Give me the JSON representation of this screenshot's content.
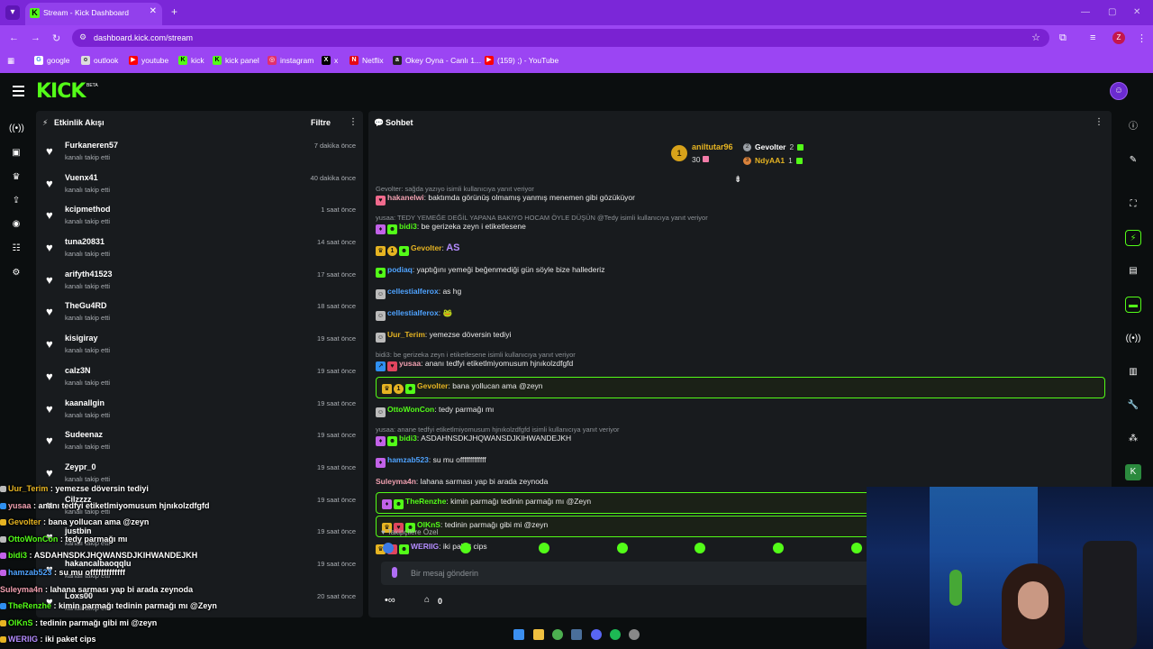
{
  "browser": {
    "tab_title": "Stream - Kick Dashboard",
    "url": "dashboard.kick.com/stream",
    "profile_initial": "Z",
    "bookmarks": [
      {
        "label": "google",
        "color": "#ffffff"
      },
      {
        "label": "outlook",
        "color": "#e0e0e0"
      },
      {
        "label": "youtube",
        "color": "#ff0000"
      },
      {
        "label": "kick",
        "color": "#53fc18"
      },
      {
        "label": "kick panel",
        "color": "#53fc18"
      },
      {
        "label": "instagram",
        "color": "#e1306c"
      },
      {
        "label": "x",
        "color": "#000000"
      },
      {
        "label": "Netflix",
        "color": "#e50914"
      },
      {
        "label": "Okey Oyna - Canlı 1...",
        "color": "#222222"
      },
      {
        "label": "(159) ;) - YouTube",
        "color": "#ff0000"
      }
    ]
  },
  "brand": {
    "logo": "KICK",
    "beta": "BETA",
    "accent": "#53fc18"
  },
  "feed": {
    "title": "Etkinlik Akışı",
    "filter_label": "Filtre",
    "items": [
      {
        "name": "Furkaneren57",
        "action": "kanalı takip etti",
        "time": "7 dakika önce"
      },
      {
        "name": "Vuenx41",
        "action": "kanalı takip etti",
        "time": "40 dakika önce"
      },
      {
        "name": "kcipmethod",
        "action": "kanalı takip etti",
        "time": "1 saat önce"
      },
      {
        "name": "tuna20831",
        "action": "kanalı takip etti",
        "time": "14 saat önce"
      },
      {
        "name": "arifyth41523",
        "action": "kanalı takip etti",
        "time": "17 saat önce"
      },
      {
        "name": "TheGu4RD",
        "action": "kanalı takip etti",
        "time": "18 saat önce"
      },
      {
        "name": "kisigiray",
        "action": "kanalı takip etti",
        "time": "19 saat önce"
      },
      {
        "name": "calz3N",
        "action": "kanalı takip etti",
        "time": "19 saat önce"
      },
      {
        "name": "kaanallgin",
        "action": "kanalı takip etti",
        "time": "19 saat önce"
      },
      {
        "name": "Sudeenaz",
        "action": "kanalı takip etti",
        "time": "19 saat önce"
      },
      {
        "name": "Zeypr_0",
        "action": "kanalı takip etti",
        "time": "19 saat önce"
      },
      {
        "name": "Cilzzzz",
        "action": "kanalı takip etti",
        "time": "19 saat önce"
      },
      {
        "name": "justbin",
        "action": "kanalı takip etti",
        "time": "19 saat önce"
      },
      {
        "name": "hakancalbaoqqlu",
        "action": "kanalı takip etti",
        "time": "19 saat önce"
      },
      {
        "name": "Loxs00",
        "action": "kanalı takip etti",
        "time": "20 saat önce"
      }
    ]
  },
  "chat": {
    "title": "Sohbet",
    "leaderboard": {
      "first_name": "aniltutar96",
      "first_count": "30",
      "second_name": "Gevolter",
      "second_count": "2",
      "third_name": "NdyAA1",
      "third_count": "1"
    },
    "messages": [
      {
        "reply": "Gevolter: sağda yazıyo isimli kullanıcıya yanıt veriyor",
        "user": "hakanelwi",
        "color": "#f0a0b0",
        "text": "baktımda görünüş olmamış yanmış menemen gibi gözüküyor"
      },
      {
        "reply": "yusaa: TEDY YEMEĞE DEĞİL YAPANA BAKIYO HOCAM ÖYLE DÜŞÜN @Tedy isimli kullanıcıya yanıt veriyor",
        "user": "bidi3",
        "color": "#53fc18",
        "text": "be gerizeka zeyn i etiketlesene"
      },
      {
        "user": "Gevolter",
        "color": "#e6b422",
        "text": "AS"
      },
      {
        "user": "podiaq",
        "color": "#4fa3ff",
        "text": "yaptığını yemeği beğenmediği gün söyle bize hallederiz"
      },
      {
        "user": "cellestialferox",
        "color": "#4fa3ff",
        "text": "as hg"
      },
      {
        "user": "cellestialferox",
        "color": "#4fa3ff",
        "text": "🐸"
      },
      {
        "user": "Uur_Terim",
        "color": "#e6b422",
        "text": "yemezse döversin tediyi"
      },
      {
        "reply": "bidi3: be gerizeka zeyn i etiketlesene isimli kullanıcıya yanıt veriyor",
        "user": "yusaa",
        "color": "#f0a0b0",
        "text": "ananı tedfyi etiketlmiyomusum hjnıkolzdfgfd"
      },
      {
        "user": "Gevolter",
        "color": "#e6b422",
        "text": "bana yollucan ama @zeyn",
        "highlight": true
      },
      {
        "user": "OttoWonCon",
        "color": "#53fc18",
        "text": "tedy parmağı mı"
      },
      {
        "reply": "yusaa: anane tedfyi etiketlmiyomusum hjnıkolzdfgfd isimli kullanıcıya yanıt veriyor",
        "user": "bidi3",
        "color": "#53fc18",
        "text": "ASDAHNSDKJHQWANSDJKIHWANDEJKH"
      },
      {
        "user": "hamzab523",
        "color": "#4fa3ff",
        "text": "su mu offfffffffffff"
      },
      {
        "user": "Suleyma4n",
        "color": "#f0a0b0",
        "text": "lahana sarması yap bi arada zeynoda"
      },
      {
        "user": "TheRenzhe",
        "color": "#53fc18",
        "text": "kimin parmağı tedinin parmağı mı @Zeyn",
        "highlight": true
      },
      {
        "user": "OlKnS",
        "color": "#53fc18",
        "text": "tedinin parmağı gibi mi @zeyn",
        "highlight": true
      },
      {
        "user": "WERIIG",
        "color": "#b48cff",
        "text": "iki paket cips"
      }
    ],
    "followers_label": "Takipçilere Özel",
    "input_placeholder": "Bir mesaj gönderin",
    "store_count": "0"
  },
  "overlay": [
    {
      "user": "Uur_Terim",
      "color": "#e6b422",
      "text": "yemezse döversin tediyi"
    },
    {
      "user": "yusaa",
      "color": "#f0a0b0",
      "text": "ananı tedfyi etiketlmiyomusum hjnıkolzdfgfd"
    },
    {
      "user": "Gevolter",
      "color": "#e6b422",
      "text": "bana yollucan ama @zeyn"
    },
    {
      "user": "OttoWonCon",
      "color": "#53fc18",
      "text": "tedy parmağı mı"
    },
    {
      "user": "bidi3",
      "color": "#53fc18",
      "text": "ASDAHNSDKJHQWANSDJKIHWANDEJKH"
    },
    {
      "user": "hamzab523",
      "color": "#4fa3ff",
      "text": "su mu offfffffffffff"
    },
    {
      "user": "Suleyma4n",
      "color": "#f0a0b0",
      "text": "lahana sarması yap bi arada zeynoda"
    },
    {
      "user": "TheRenzhe",
      "color": "#53fc18",
      "text": "kimin parmağı tedinin parmağı mı @Zeyn"
    },
    {
      "user": "OlKnS",
      "color": "#53fc18",
      "text": "tedinin parmağı gibi mi @zeyn"
    },
    {
      "user": "WERIIG",
      "color": "#b48cff",
      "text": "iki paket cips"
    }
  ],
  "icons": {
    "left_rail": [
      "live-icon",
      "dashboard-icon",
      "trophy-icon",
      "upload-icon",
      "camera-icon",
      "users-icon",
      "settings-icon"
    ],
    "right_rail": [
      "info-icon",
      "edit-icon",
      "fullscreen-icon",
      "bolt-icon",
      "document-icon",
      "chat-icon",
      "broadcast-icon",
      "store-icon",
      "wrench-icon",
      "share-icon",
      "kick-icon"
    ]
  }
}
